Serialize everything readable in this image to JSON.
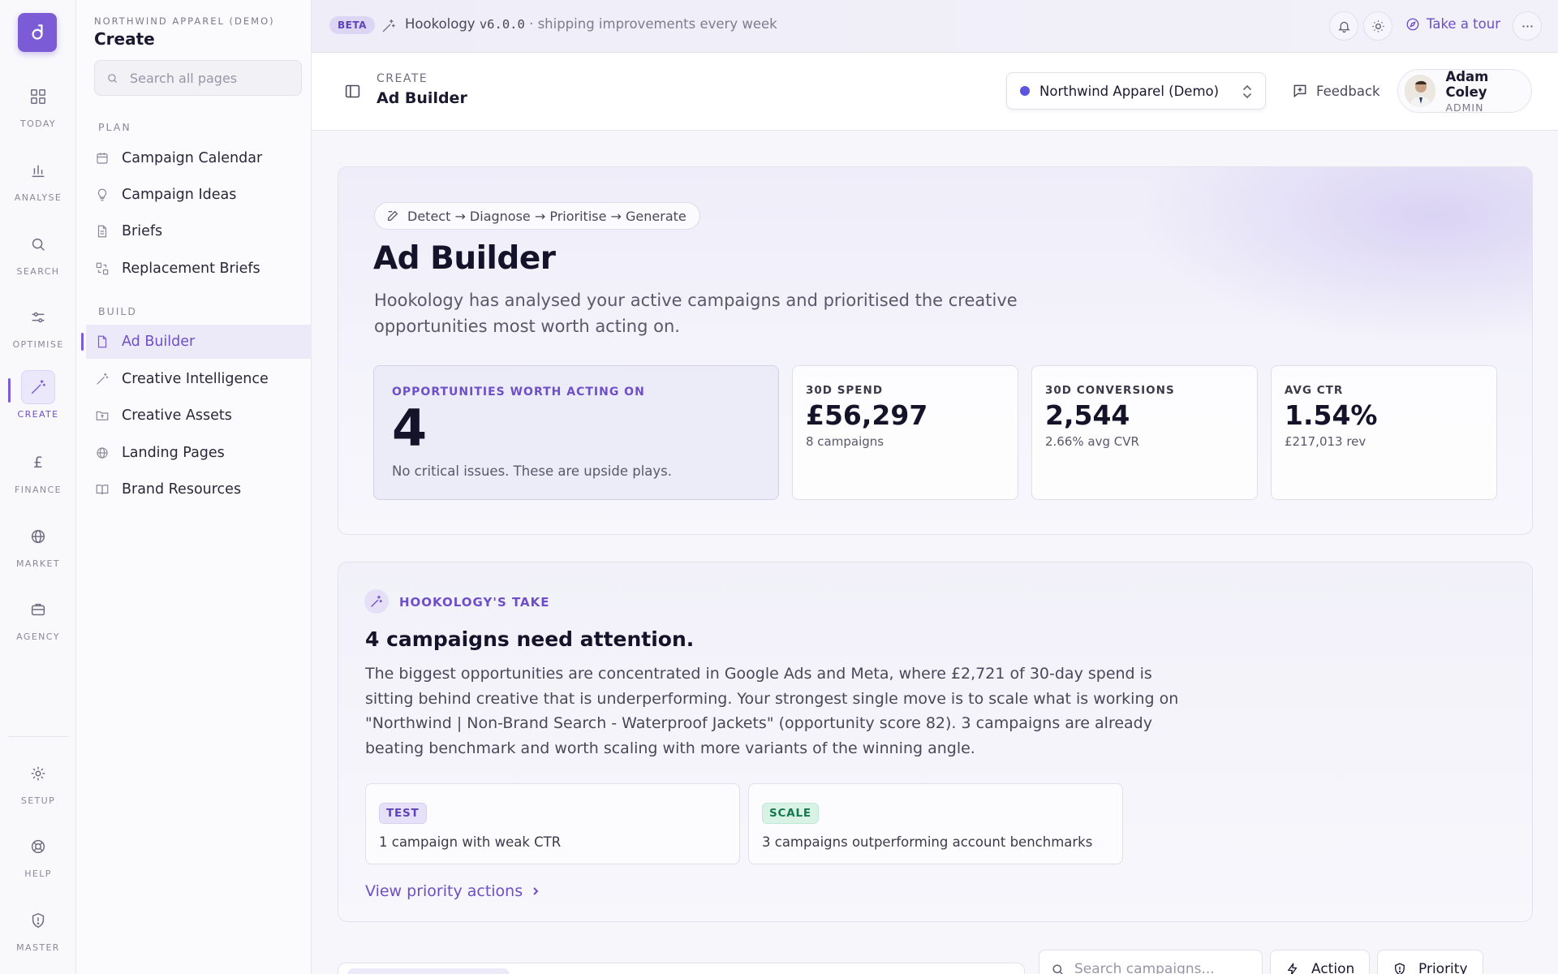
{
  "rail": {
    "items": [
      {
        "label": "TODAY",
        "icon": "grid-icon"
      },
      {
        "label": "ANALYSE",
        "icon": "bar-chart-icon"
      },
      {
        "label": "SEARCH",
        "icon": "search-icon"
      },
      {
        "label": "OPTIMISE",
        "icon": "sliders-icon"
      },
      {
        "label": "CREATE",
        "icon": "magic-wand-icon",
        "active": true
      },
      {
        "label": "FINANCE",
        "icon": "pound-icon"
      },
      {
        "label": "MARKET",
        "icon": "globe-icon"
      },
      {
        "label": "AGENCY",
        "icon": "briefcase-icon"
      }
    ],
    "bottom": [
      {
        "label": "SETUP",
        "icon": "gear-icon"
      },
      {
        "label": "HELP",
        "icon": "lifebuoy-icon"
      },
      {
        "label": "MASTER",
        "icon": "shield-icon"
      }
    ]
  },
  "sidebar": {
    "org": "NORTHWIND APPAREL (DEMO)",
    "title": "Create",
    "search_placeholder": "Search all pages",
    "groups": [
      {
        "label": "PLAN",
        "items": [
          "Campaign Calendar",
          "Campaign Ideas",
          "Briefs",
          "Replacement Briefs"
        ]
      },
      {
        "label": "BUILD",
        "items": [
          "Ad Builder",
          "Creative Intelligence",
          "Creative Assets",
          "Landing Pages",
          "Brand Resources"
        ]
      }
    ],
    "active": "Ad Builder"
  },
  "banner": {
    "badge": "BETA",
    "product": "Hookology",
    "version": "v6.0.0",
    "note": "· shipping improvements every week",
    "tour": "Take a tour"
  },
  "header": {
    "section": "CREATE",
    "page": "Ad Builder",
    "org_select": "Northwind Apparel (Demo)",
    "feedback": "Feedback",
    "user_name": "Adam Coley",
    "user_role": "ADMIN"
  },
  "hero": {
    "pill": "Detect → Diagnose → Prioritise → Generate",
    "title": "Ad Builder",
    "subtitle": "Hookology has analysed your active campaigns and prioritised the creative opportunities most worth acting on.",
    "stats": [
      {
        "label": "OPPORTUNITIES WORTH ACTING ON",
        "value": "4",
        "sub": "No critical issues. These are upside plays."
      },
      {
        "label": "30D SPEND",
        "value": "£56,297",
        "sub": "8 campaigns"
      },
      {
        "label": "30D CONVERSIONS",
        "value": "2,544",
        "sub": "2.66% avg CVR"
      },
      {
        "label": "AVG CTR",
        "value": "1.54%",
        "sub": "£217,013 rev"
      }
    ]
  },
  "take": {
    "label": "HOOKOLOGY'S TAKE",
    "title": "4 campaigns need attention.",
    "body": "The biggest opportunities are concentrated in Google Ads and Meta, where £2,721 of 30-day spend is sitting behind creative that is underperforming. Your strongest single move is to scale what is working on \"Northwind | Non-Brand Search - Waterproof Jackets\" (opportunity score 82). 3 campaigns are already beating benchmark and worth scaling with more variants of the winning angle.",
    "cards": [
      {
        "tag": "TEST",
        "text": "1 campaign with weak CTR"
      },
      {
        "tag": "SCALE",
        "text": "3 campaigns outperforming account benchmarks"
      }
    ],
    "link": "View priority actions"
  },
  "toolbar": {
    "search_placeholder": "Search campaigns...",
    "action": "Action",
    "priority": "Priority"
  },
  "colors": {
    "accent": "#7c5cd6",
    "accent_text": "#6e4fc8",
    "scale_green": "#137a4e"
  }
}
